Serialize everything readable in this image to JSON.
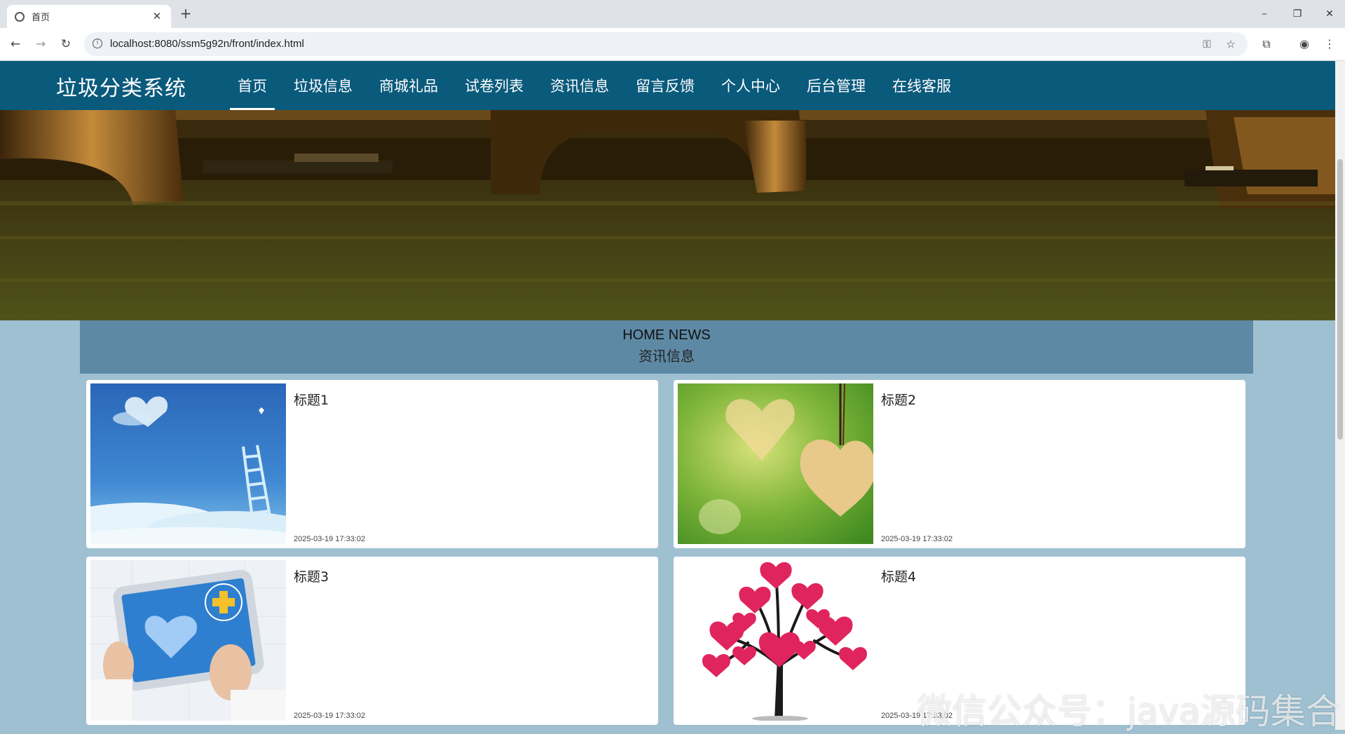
{
  "browser": {
    "tab_title": "首页",
    "url": "localhost:8080/ssm5g92n/front/index.html"
  },
  "site": {
    "brand": "垃圾分类系统",
    "menu": [
      {
        "label": "首页",
        "active": true
      },
      {
        "label": "垃圾信息",
        "active": false
      },
      {
        "label": "商城礼品",
        "active": false
      },
      {
        "label": "试卷列表",
        "active": false
      },
      {
        "label": "资讯信息",
        "active": false
      },
      {
        "label": "留言反馈",
        "active": false
      },
      {
        "label": "个人中心",
        "active": false
      },
      {
        "label": "后台管理",
        "active": false
      },
      {
        "label": "在线客服",
        "active": false
      }
    ]
  },
  "banner": {
    "slide_count": 3,
    "active_slide": 1
  },
  "news": {
    "title_en": "HOME NEWS",
    "title_cn": "资讯信息",
    "items": [
      {
        "title": "标题1",
        "time": "2025-03-19 17:33:02"
      },
      {
        "title": "标题2",
        "time": "2025-03-19 17:33:02"
      },
      {
        "title": "标题3",
        "time": "2025-03-19 17:33:02"
      },
      {
        "title": "标题4",
        "time": "2025-03-19 17:33:02"
      }
    ]
  },
  "watermark": "微信公众号：java源码集合",
  "colors": {
    "nav_bg": "#0a5a7c",
    "page_bg": "#9fc0d1",
    "news_head_bg": "#5e89a5"
  }
}
